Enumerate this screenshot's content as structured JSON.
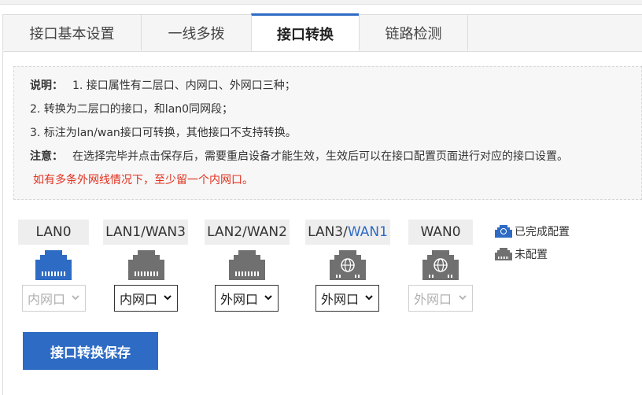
{
  "tabs": [
    {
      "label": "接口基本设置"
    },
    {
      "label": "一线多拨"
    },
    {
      "label": "接口转换"
    },
    {
      "label": "链路检测"
    }
  ],
  "notes": {
    "line1_title": "说明：",
    "line1_text": "1. 接口属性有二层口、内网口、外网口三种；",
    "line2": "2. 转换为二层口的接口，和lan0同网段；",
    "line3": "3. 标注为lan/wan接口可转换，其他接口不支持转换。",
    "line4_title": "注意：",
    "line4_text": "在选择完毕并点击保存后，需要重启设备才能生效，生效后可以在接口配置页面进行对应的接口设置。",
    "warning": "如有多条外网线情况下，至少留一个内网口。"
  },
  "ports": [
    {
      "label": "LAN0",
      "label_suffix": "",
      "status": "configured",
      "icon": "ethernet-port-icon",
      "value": "内网口",
      "disabled": true
    },
    {
      "label": "LAN1/WAN3",
      "label_suffix": "",
      "status": "unconfigured",
      "icon": "ethernet-port-icon",
      "value": "内网口",
      "disabled": false
    },
    {
      "label": "LAN2/WAN2",
      "label_suffix": "",
      "status": "unconfigured",
      "icon": "ethernet-port-icon",
      "value": "外网口",
      "disabled": false
    },
    {
      "label": "LAN3/",
      "label_suffix": "WAN1",
      "status": "unconfigured",
      "icon": "globe-port-icon",
      "value": "外网口",
      "disabled": false
    },
    {
      "label": "WAN0",
      "label_suffix": "",
      "status": "unconfigured",
      "icon": "globe-port-icon",
      "value": "外网口",
      "disabled": true
    }
  ],
  "legend": {
    "configured": "已完成配置",
    "unconfigured": "未配置"
  },
  "save_button": "接口转换保存",
  "colors": {
    "accent": "#2d6bc4",
    "configured_port": "#2d6bc4",
    "unconfigured_port": "#707070",
    "warning": "#e0301e"
  }
}
